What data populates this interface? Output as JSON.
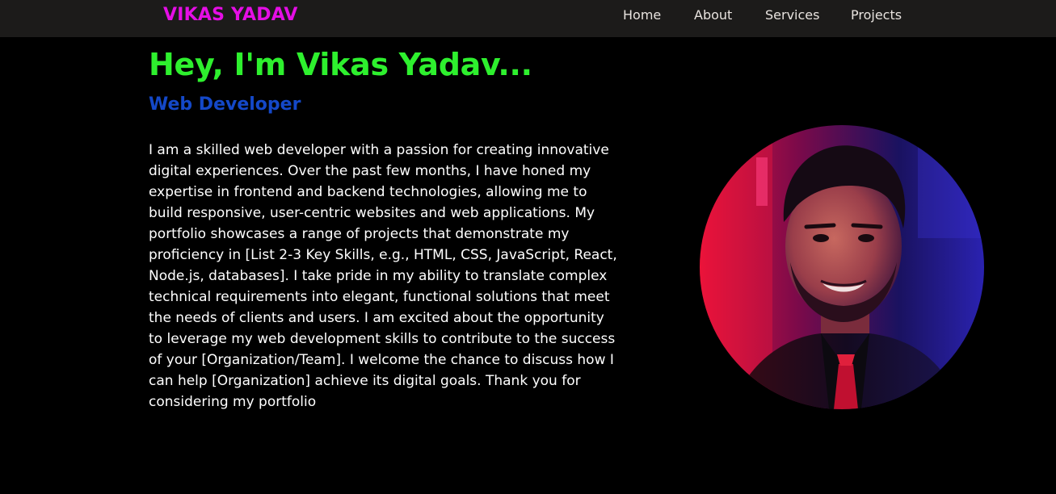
{
  "nav": {
    "brand": "VIKAS YADAV",
    "items": [
      {
        "label": "Home"
      },
      {
        "label": "About"
      },
      {
        "label": "Services"
      },
      {
        "label": "Projects"
      }
    ]
  },
  "hero": {
    "title": "Hey, I'm Vikas Yadav...",
    "role": "Web Developer",
    "description": "I am a skilled web developer with a passion for creating innovative digital experiences. Over the past few months, I have honed my expertise in frontend and backend technologies, allowing me to build responsive, user-centric websites and web applications. My portfolio showcases a range of projects that demonstrate my proficiency in [List 2-3 Key Skills, e.g., HTML, CSS, JavaScript, React, Node.js, databases]. I take pride in my ability to translate complex technical requirements into elegant, functional solutions that meet the needs of clients and users. I am excited about the opportunity to leverage my web development skills to contribute to the success of your [Organization/Team]. I welcome the chance to discuss how I can help [Organization] achieve its digital goals. Thank you for considering my portfolio"
  },
  "colors": {
    "background": "#000000",
    "navbar": "#1c1b1a",
    "brand": "#e50ee5",
    "title": "#2ef02e",
    "role": "#1448c8",
    "text": "#ffffff"
  }
}
